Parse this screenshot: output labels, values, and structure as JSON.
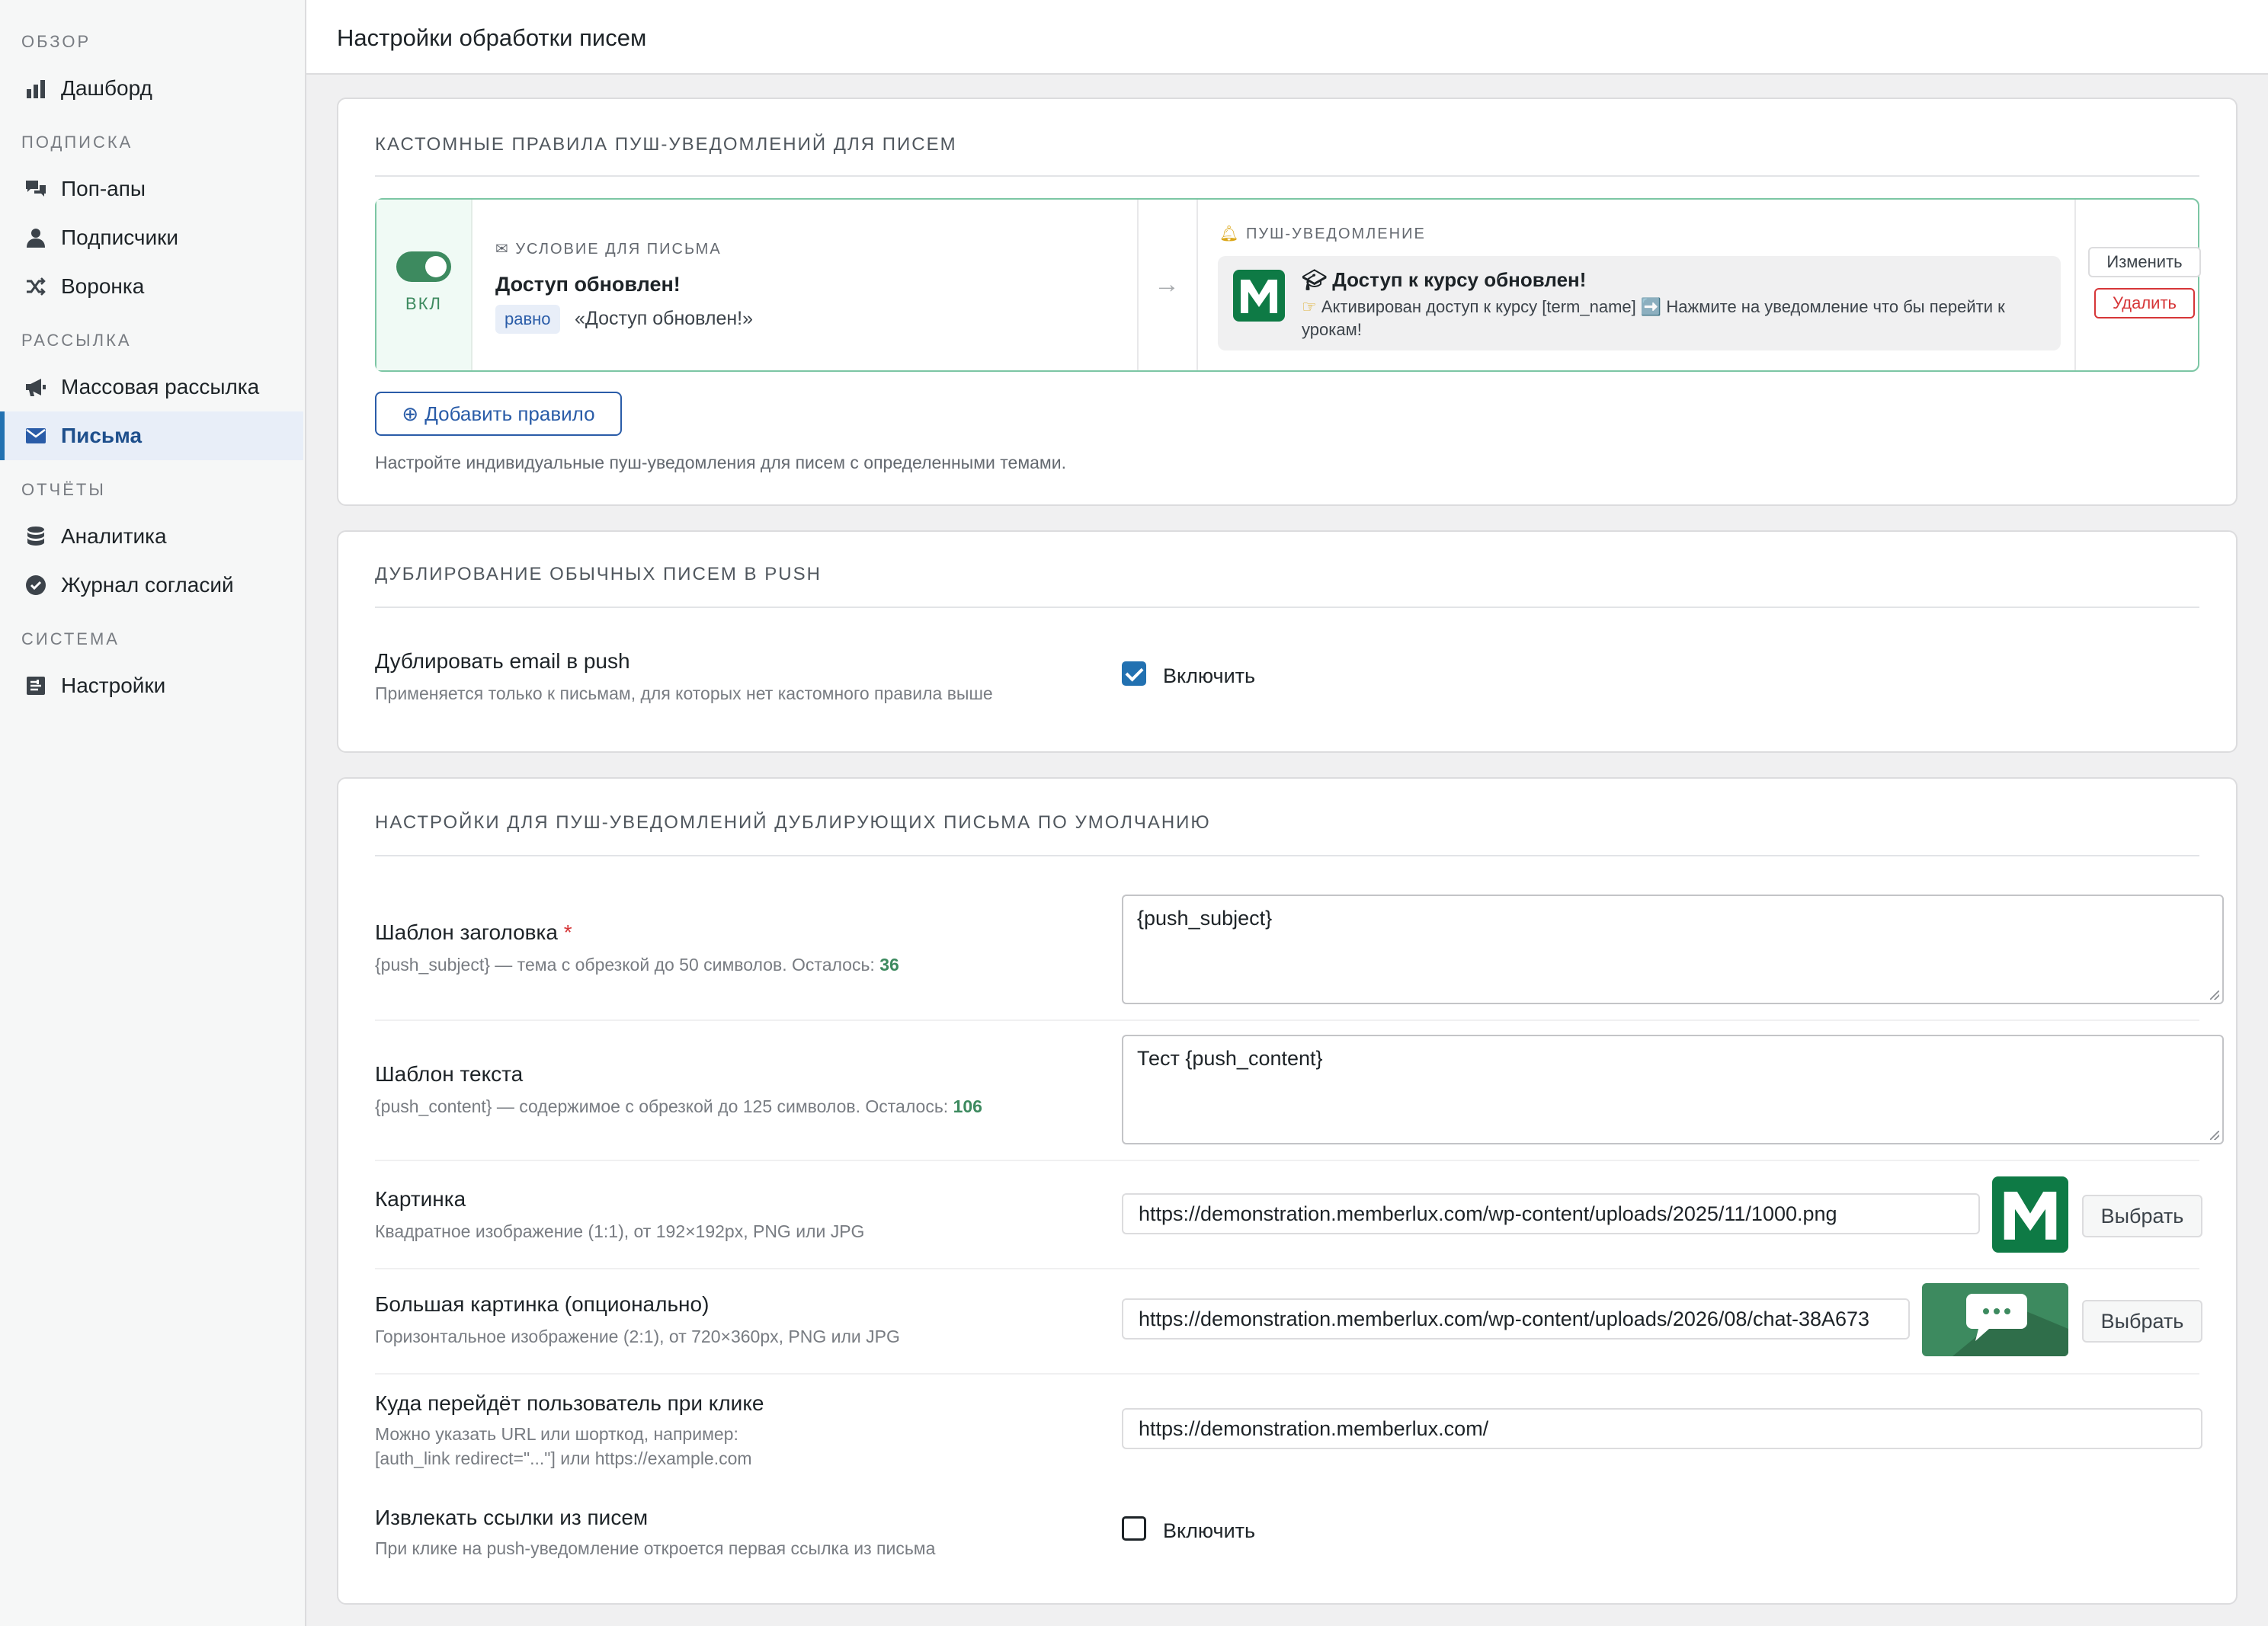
{
  "sidebar": {
    "groups": [
      {
        "title": "Обзор",
        "items": [
          {
            "label": "Дашборд",
            "icon": "bar-chart-icon"
          }
        ]
      },
      {
        "title": "Подписка",
        "items": [
          {
            "label": "Поп-апы",
            "icon": "comments-icon"
          },
          {
            "label": "Подписчики",
            "icon": "user-icon"
          },
          {
            "label": "Воронка",
            "icon": "shuffle-icon"
          }
        ]
      },
      {
        "title": "Рассылка",
        "items": [
          {
            "label": "Массовая рассылка",
            "icon": "megaphone-icon"
          },
          {
            "label": "Письма",
            "icon": "envelope-icon",
            "active": true
          }
        ]
      },
      {
        "title": "Отчёты",
        "items": [
          {
            "label": "Аналитика",
            "icon": "database-icon"
          },
          {
            "label": "Журнал согласий",
            "icon": "check-circle-icon"
          }
        ]
      },
      {
        "title": "Система",
        "items": [
          {
            "label": "Настройки",
            "icon": "settings-icon"
          }
        ]
      }
    ]
  },
  "header": {
    "title": "Настройки обработки писем"
  },
  "rules_card": {
    "title": "Кастомные правила пуш-уведомлений для писем",
    "rule": {
      "toggle_label": "ВКЛ",
      "condition_label": "Условие для письма",
      "condition_title": "Доступ обновлен!",
      "operator": "равно",
      "value": "«Доступ обновлен!»",
      "push_label": "Пуш-уведомление",
      "push_title": "Доступ к курсу обновлен!",
      "push_text": "Активирован доступ к курсу [term_name] ➡️ Нажмите на уведомление что бы перейти к урокам!",
      "edit_label": "Изменить",
      "delete_label": "Удалить"
    },
    "add_label": "Добавить правило",
    "help": "Настройте индивидуальные пуш-уведомления для писем с определенными темами."
  },
  "dup_card": {
    "title": "Дублирование обычных писем в push",
    "field_label": "Дублировать email в push",
    "field_desc": "Применяется только к письмам, для которых нет кастомного правила выше",
    "checkbox_label": "Включить",
    "checked": true
  },
  "defaults_card": {
    "title": "Настройки для пуш-уведомлений дублирующих письма по умолчанию",
    "subject": {
      "label": "Шаблон заголовка",
      "required_mark": "*",
      "desc": "{push_subject} — тема с обрезкой до 50 символов. Осталось:",
      "remaining": "36",
      "value": "{push_subject}"
    },
    "content": {
      "label": "Шаблон текста",
      "desc": "{push_content} — содержимое с обрезкой до 125 символов. Осталось:",
      "remaining": "106",
      "value": "Тест {push_content}"
    },
    "image": {
      "label": "Картинка",
      "desc": "Квадратное изображение (1:1), от 192×192px, PNG или JPG",
      "value": "https://demonstration.memberlux.com/wp-content/uploads/2025/11/1000.png",
      "pick_label": "Выбрать"
    },
    "big_image": {
      "label": "Большая картинка (опционально)",
      "desc": "Горизонтальное изображение (2:1), от 720×360px, PNG или JPG",
      "value": "https://demonstration.memberlux.com/wp-content/uploads/2026/08/chat-38A673",
      "pick_label": "Выбрать"
    },
    "click_url": {
      "label": "Куда перейдёт пользователь при клике",
      "desc_line1": "Можно указать URL или шорткод, например:",
      "desc_line2": "[auth_link redirect=\"...\"] или https://example.com",
      "value": "https://demonstration.memberlux.com/"
    },
    "extract_links": {
      "label": "Извлекать ссылки из писем",
      "desc": "При клике на push-уведомление откроется первая ссылка из письма",
      "checkbox_label": "Включить",
      "checked": false
    }
  },
  "colors": {
    "accent": "#2271b1",
    "brand_green": "#0e7a45",
    "danger": "#d63638"
  }
}
